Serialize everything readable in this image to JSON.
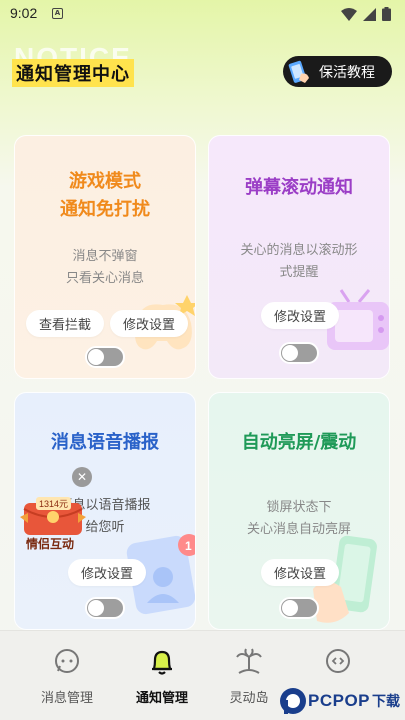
{
  "status_bar": {
    "time": "9:02",
    "notif_icon": "A"
  },
  "header": {
    "watermark": "NOTICE",
    "title": "通知管理中心",
    "tutorial_label": "保活教程"
  },
  "cards": [
    {
      "title_lines": [
        "游戏模式",
        "通知免打扰"
      ],
      "desc_lines": [
        "消息不弹窗",
        "只看关心消息"
      ],
      "buttons": [
        "查看拦截",
        "修改设置"
      ],
      "title_color": "#f08a1c",
      "enabled": false
    },
    {
      "title_lines": [
        "弹幕滚动通知"
      ],
      "desc_lines": [
        "关心的消息以滚动形",
        "式提醒"
      ],
      "buttons": [
        "修改设置"
      ],
      "title_color": "#9b3ec6",
      "enabled": false
    },
    {
      "title_lines": [
        "消息语音播报"
      ],
      "desc_lines": [
        "消息以语音播报",
        "给您听"
      ],
      "buttons": [
        "修改设置"
      ],
      "title_color": "#2a62c9",
      "enabled": false
    },
    {
      "title_lines": [
        "自动亮屏/震动"
      ],
      "desc_lines": [
        "锁屏状态下",
        "关心消息自动亮屏"
      ],
      "buttons": [
        "修改设置"
      ],
      "title_color": "#1f9a58",
      "enabled": false
    }
  ],
  "float_badge": {
    "number": "1314元",
    "label": "情侣互动"
  },
  "bottom_nav": {
    "items": [
      {
        "label": "消息管理",
        "icon": "chat-bubble-icon",
        "active": false
      },
      {
        "label": "通知管理",
        "icon": "bell-icon",
        "active": true
      },
      {
        "label": "灵动岛",
        "icon": "palm-tree-icon",
        "active": false
      },
      {
        "label": "",
        "icon": "smile-chat-icon",
        "active": false
      }
    ]
  },
  "watermark_logo": {
    "text": "PCPOP",
    "suffix": "下载"
  }
}
